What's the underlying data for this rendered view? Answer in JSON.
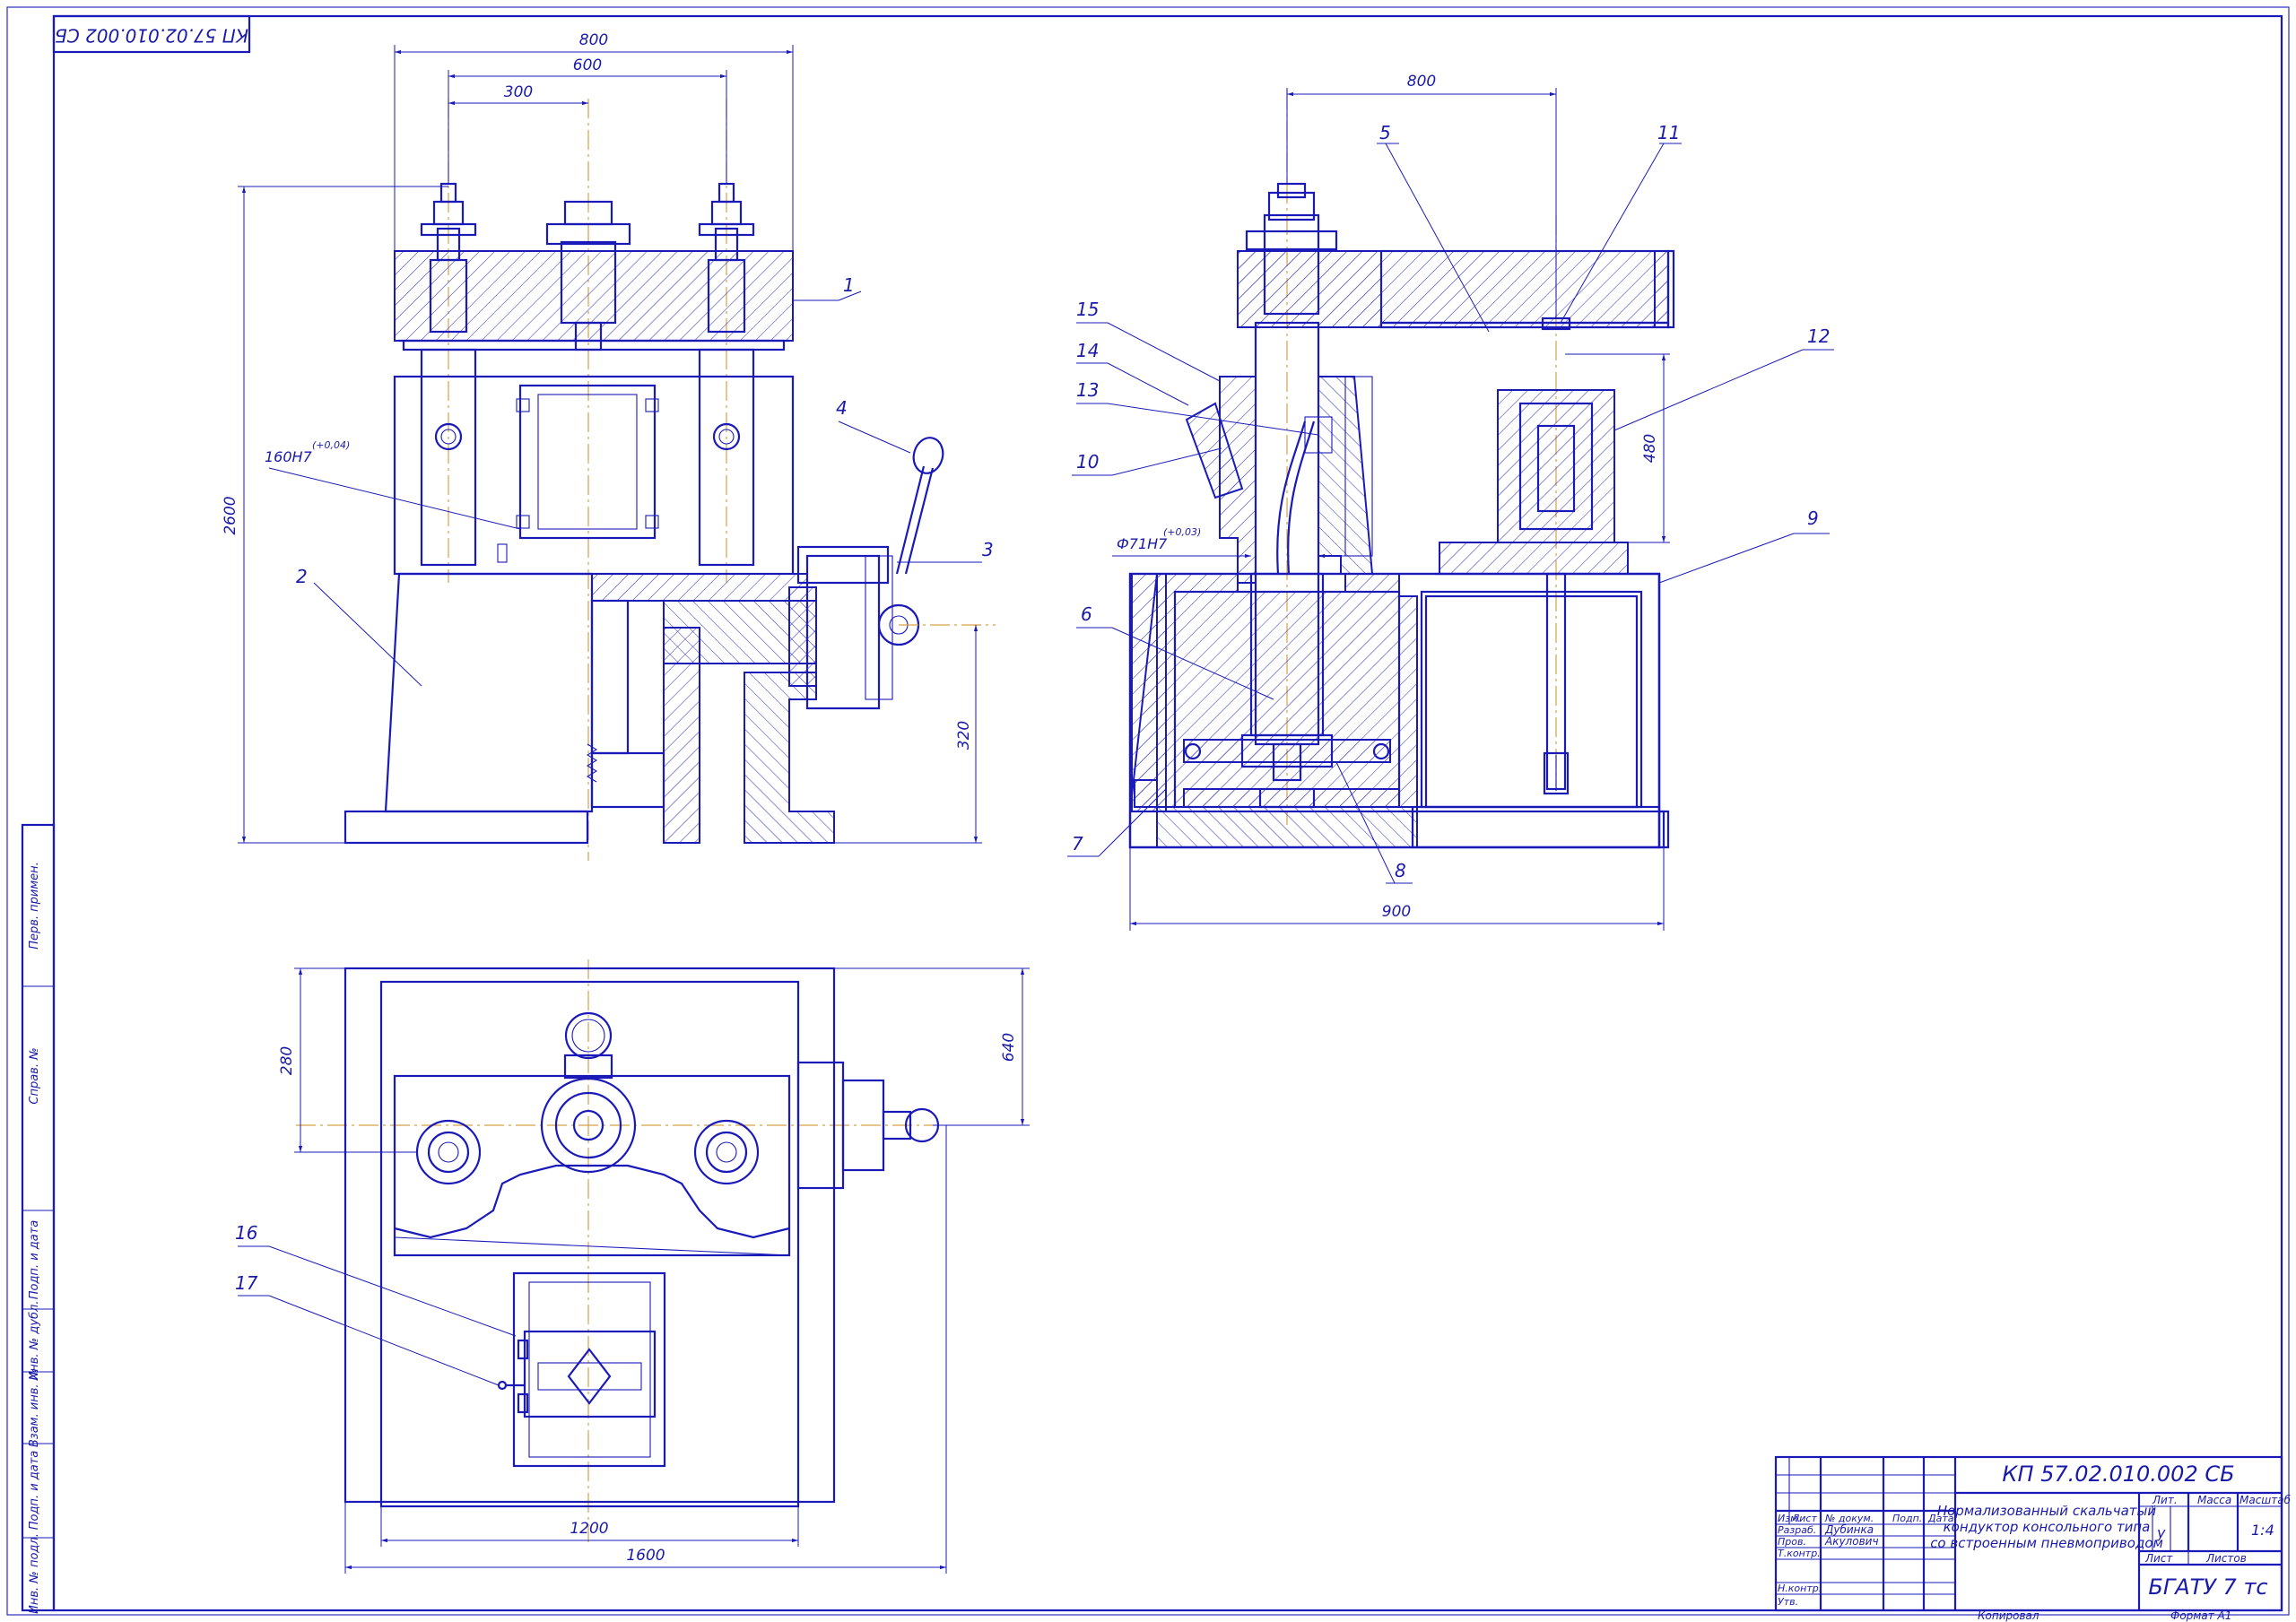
{
  "drawing": {
    "code_stamp": "КП 57.02.010.002 СБ",
    "dimensions": {
      "d800_front": "800",
      "d600": "600",
      "d300": "300",
      "d2600": "2600",
      "d320": "320",
      "d160": "160H7",
      "d160_tol": "(+0,04)",
      "d800_side": "800",
      "d480": "480",
      "d900": "900",
      "d71": "Ф71H7",
      "d71_tol": "(+0,03)",
      "d280": "280",
      "d640": "640",
      "d1200": "1200",
      "d1600": "1600"
    },
    "callouts": [
      "1",
      "2",
      "3",
      "4",
      "5",
      "6",
      "7",
      "8",
      "9",
      "10",
      "11",
      "12",
      "13",
      "14",
      "15",
      "16",
      "17"
    ],
    "side_strip": [
      "Перв. примен.",
      "Справ. №",
      "Подп. и дата",
      "Инв. № дубл.",
      "Взам. инв. №",
      "Подп. и дата",
      "Инв. № подл."
    ]
  },
  "title_block": {
    "code": "КП 57.02.010.002 СБ",
    "title_lines": [
      "Нормализованный скальчатый",
      "кондуктор консольного типа",
      "со встроенным пневмоприводом"
    ],
    "col_headers": [
      "Изм.",
      "Лист",
      "№ докум.",
      "Подп.",
      "Дата"
    ],
    "roles": [
      "Разраб.",
      "Пров.",
      "Т.контр.",
      "Н.контр.",
      "Утв."
    ],
    "names": [
      "Дубинка",
      "Акулович"
    ],
    "lit_label": "Лит.",
    "lit_value": "у",
    "mass_label": "Масса",
    "scale_label": "Масштаб",
    "scale_value": "1:4",
    "sheet_label": "Лист",
    "sheets_label": "Листов",
    "org": "БГАТУ 7 тс",
    "copied": "Копировал",
    "format": "Формат   А1"
  }
}
